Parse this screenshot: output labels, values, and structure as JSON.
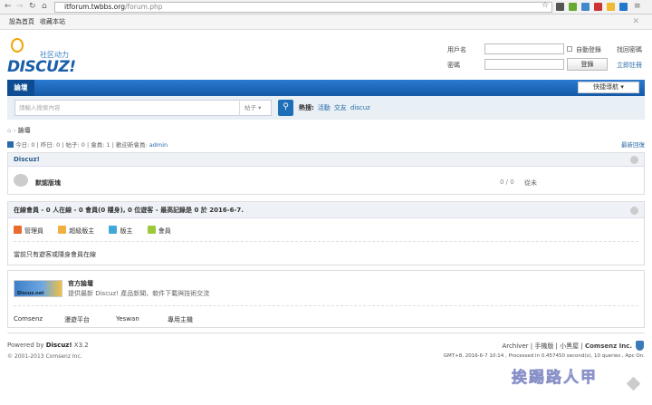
{
  "browser": {
    "url_host": "itforum.twbbs.org",
    "url_path": "/forum.php"
  },
  "topbar": {
    "items": [
      "設為首頁",
      "收藏本站"
    ]
  },
  "header": {
    "slogan": "社区动力",
    "logo": "DISCUZ!",
    "username_label": "用戶名",
    "password_label": "密碼",
    "auto_login": "自動登錄",
    "login_button": "登錄",
    "forgot": "找回密碼",
    "register": "立即註冊"
  },
  "nav": {
    "tab": "論壇",
    "quick_nav": "快捷導航"
  },
  "search": {
    "placeholder": "請輸入搜索內容",
    "type": "帖子",
    "hot_label": "熱搜:",
    "hot": [
      "活動",
      "交友",
      "discuz"
    ]
  },
  "breadcrumb": {
    "current": "論壇"
  },
  "stats": {
    "text_today": "今日: 0",
    "yesterday": "昨日: 0",
    "posts": "帖子: 0",
    "members": "會員: 1",
    "welcome": "歡迎新會員: ",
    "newest": "admin",
    "latest_reply": "最新回復"
  },
  "category": {
    "title": "Discuz!",
    "forum": "默認版塊",
    "counts": "0 / 0",
    "last": "從未"
  },
  "online": {
    "title": "在線會員 - 0 人在線 - 0 會員(0 隱身), 0 位遊客 - 最高記錄是 0 於 2016-6-7.",
    "legend": [
      {
        "label": "管理員",
        "color": "#e86a2c"
      },
      {
        "label": "超級版主",
        "color": "#f0b040"
      },
      {
        "label": "版主",
        "color": "#3fa8d8"
      },
      {
        "label": "會員",
        "color": "#9cc83a"
      }
    ],
    "note": "當前只有遊客或隱身會員在線"
  },
  "links": {
    "official_title": "官方論壇",
    "official_desc": "提供最新 Discuz! 產品新聞、軟件下載與技術交流",
    "logo_text": "Discuz.net",
    "items": [
      "Comsenz",
      "漫遊平台",
      "Yeswan",
      "專用主機"
    ]
  },
  "footer": {
    "powered": "Powered by ",
    "brand": "Discuz!",
    "version": " X3.2",
    "copyright": "© 2001-2013 Comsenz Inc.",
    "links": [
      "Archiver",
      "手機版",
      "小黑屋",
      "Comsenz Inc."
    ],
    "info": "GMT+8, 2016-6-7 10:14 , Processed in 0.457450 second(s), 10 queries , Apc On."
  },
  "watermark": "挨踢路人甲"
}
